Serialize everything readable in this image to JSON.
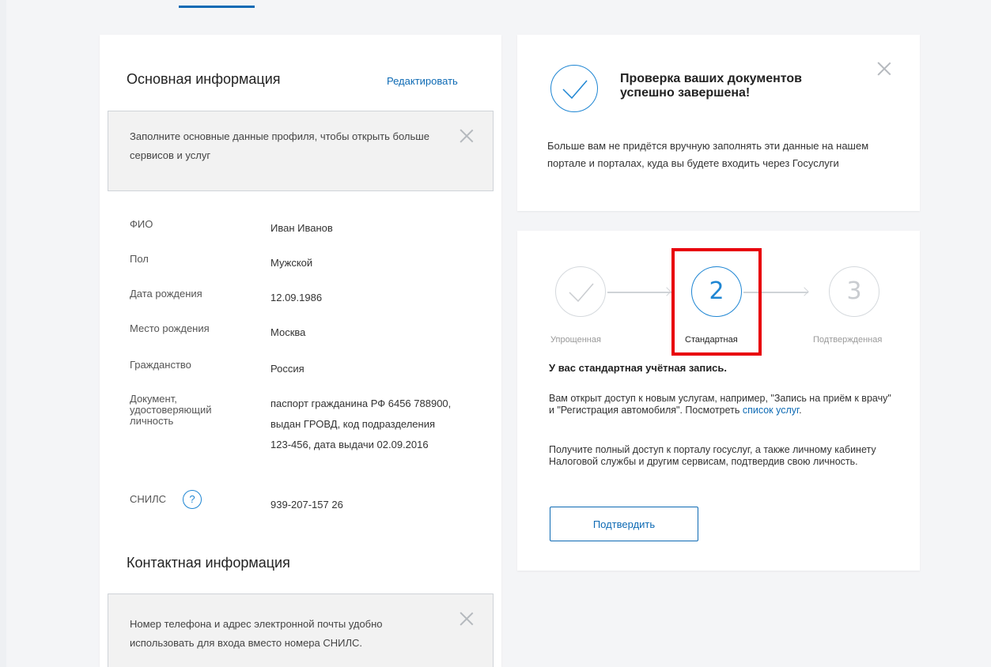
{
  "basic_info": {
    "title": "Основная информация",
    "edit_label": "Редактировать",
    "hint": "Заполните основные данные профиля, чтобы открыть больше сервисов и услуг",
    "fields": [
      {
        "label": "ФИО",
        "value": "Иван Иванов"
      },
      {
        "label": "Пол",
        "value": "Мужской"
      },
      {
        "label": "Дата рождения",
        "value": "12.09.1986"
      },
      {
        "label": "Место рождения",
        "value": "Москва"
      },
      {
        "label": "Гражданство",
        "value": "Россия"
      },
      {
        "label": "Документ, удостоверяющий личность",
        "value": "паспорт гражданина РФ 6456 788900, выдан ГРОВД, код подразделения 123-456, дата выдачи 02.09.2016"
      },
      {
        "label": "СНИЛС",
        "value": "939-207-157 26"
      }
    ],
    "help_icon_text": "?"
  },
  "contact_info": {
    "title": "Контактная информация",
    "hint": "Номер телефона и адрес электронной почты удобно использовать для входа вместо номера СНИЛС."
  },
  "verification": {
    "title": "Проверка ваших документов успешно завершена!",
    "text": "Больше вам не придётся вручную заполнять эти данные на нашем портале и порталах, куда вы будете входить через Госуслуги"
  },
  "account_level": {
    "steps": [
      {
        "number": "",
        "label": "Упрощенная",
        "state": "done"
      },
      {
        "number": "2",
        "label": "Стандартная",
        "state": "current"
      },
      {
        "number": "3",
        "label": "Подтвержденная",
        "state": "upcoming"
      }
    ],
    "heading": "У вас стандартная учётная запись.",
    "text1": "Вам открыт доступ к новым услугам, например, \"Запись на приём к врачу\" и \"Регистрация автомобиля\". Посмотреть",
    "link_label": "список услуг",
    "text2": "Получите полный доступ к порталу госуслуг, а также личному кабинету Налоговой службы и другим сервисам, подтвердив свою личность.",
    "button_label": "Подтвердить"
  },
  "colors": {
    "accent": "#0d6ab4",
    "highlight": "#e8000b"
  }
}
